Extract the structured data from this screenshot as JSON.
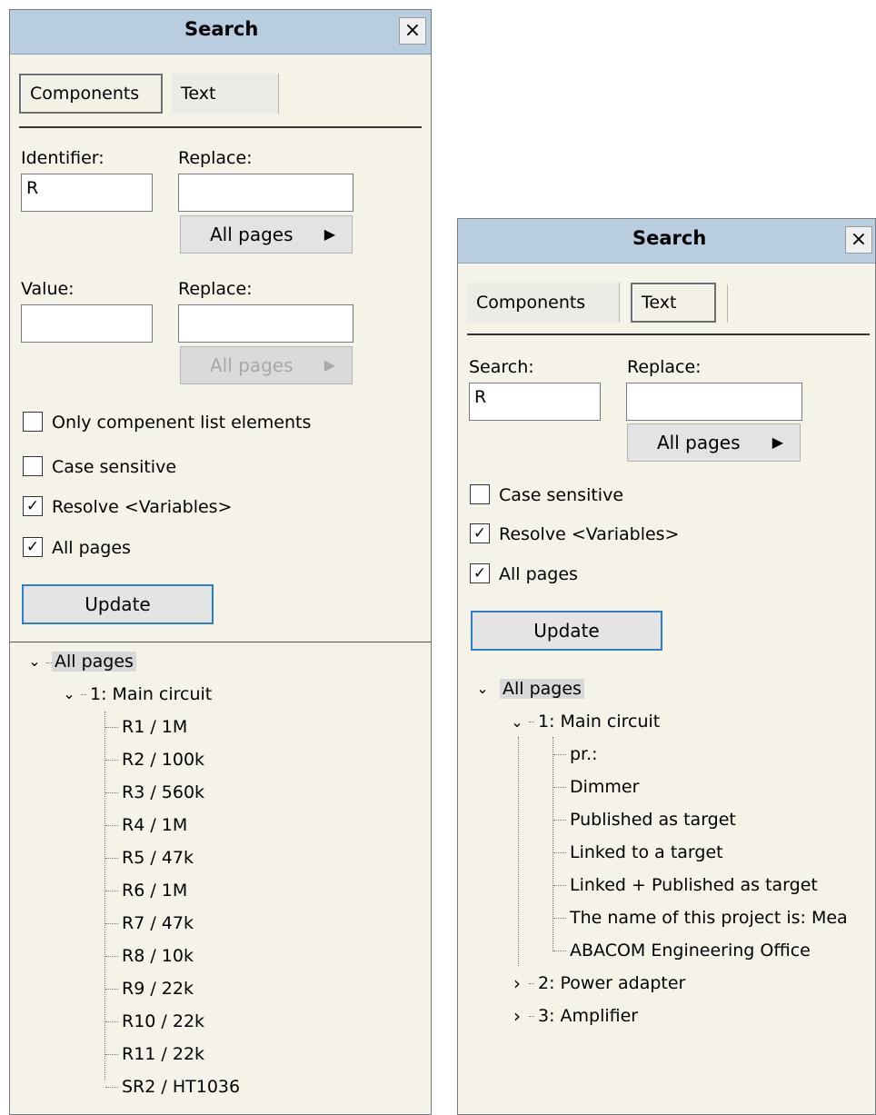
{
  "left_panel": {
    "title": "Search",
    "close_glyph": "×",
    "tabs": [
      {
        "label": "Components",
        "active": true
      },
      {
        "label": "Text",
        "active": false
      }
    ],
    "identifier": {
      "label": "Identifier:",
      "value": "R",
      "replace_label": "Replace:",
      "replace_value": "",
      "button": "All pages",
      "button_enabled": true
    },
    "value": {
      "label": "Value:",
      "value": "",
      "replace_label": "Replace:",
      "replace_value": "",
      "button": "All pages",
      "button_enabled": false
    },
    "checkboxes": [
      {
        "label": "Only compenent list elements",
        "checked": false
      },
      {
        "label": "Case sensitive",
        "checked": false
      },
      {
        "label": "Resolve <Variables>",
        "checked": true
      },
      {
        "label": "All pages",
        "checked": true
      }
    ],
    "update_label": "Update",
    "tree": {
      "root": "All pages",
      "page": "1: Main circuit",
      "items": [
        "R1 / 1M",
        "R2 / 100k",
        "R3 / 560k",
        "R4 / 1M",
        "R5 / 47k",
        "R6 / 1M",
        "R7 / 47k",
        "R8 / 10k",
        "R9 / 22k",
        "R10 / 22k",
        "R11 / 22k",
        "SR2 / HT1036"
      ]
    }
  },
  "right_panel": {
    "title": "Search",
    "close_glyph": "×",
    "tabs": [
      {
        "label": "Components",
        "active": false
      },
      {
        "label": "Text",
        "active": true
      }
    ],
    "search": {
      "label": "Search:",
      "value": "R",
      "replace_label": "Replace:",
      "replace_value": "",
      "button": "All pages",
      "button_enabled": true
    },
    "checkboxes": [
      {
        "label": "Case sensitive",
        "checked": false
      },
      {
        "label": "Resolve <Variables>",
        "checked": true
      },
      {
        "label": "All pages",
        "checked": true
      }
    ],
    "update_label": "Update",
    "tree": {
      "root": "All pages",
      "page1": "1: Main circuit",
      "items": [
        "pr.:",
        "Dimmer",
        "Published as target",
        "Linked to a target",
        "Linked + Published as target",
        "The name of this project is: Mea",
        "ABACOM Engineering Office"
      ],
      "page2": "2: Power adapter",
      "page3": "3: Amplifier"
    }
  },
  "glyphs": {
    "expanded": "⌄",
    "collapsed": "›",
    "arrow": "▶",
    "check": "✓"
  }
}
